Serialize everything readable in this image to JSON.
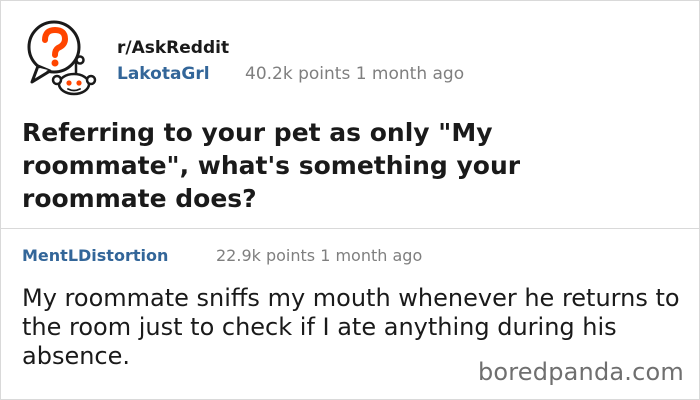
{
  "post": {
    "subreddit": "r/AskReddit",
    "author": "LakotaGrl",
    "points_time": "40.2k points 1 month ago",
    "title": "Referring to your pet as only \"My roommate\", what's something your roommate does?",
    "avatar_icon": "reddit-question-mascot-icon"
  },
  "comment": {
    "author": "MentLDistortion",
    "points_time": "22.9k points 1 month ago",
    "body": "My roommate sniffs my mouth whenever he returns to the room just to check if I ate anything during his absence."
  },
  "watermark": "boredpanda.com",
  "colors": {
    "author_link": "#336699",
    "meta_text": "#7f7f7f",
    "avatar_orange": "#ff4500",
    "divider": "#d9d9d9"
  }
}
